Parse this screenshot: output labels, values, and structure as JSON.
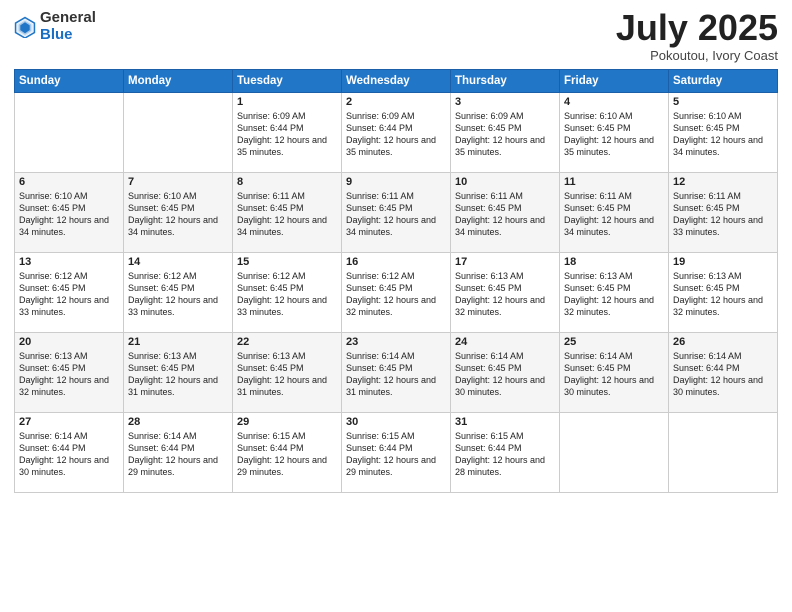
{
  "header": {
    "logo_general": "General",
    "logo_blue": "Blue",
    "title": "July 2025",
    "location": "Pokoutou, Ivory Coast"
  },
  "days_of_week": [
    "Sunday",
    "Monday",
    "Tuesday",
    "Wednesday",
    "Thursday",
    "Friday",
    "Saturday"
  ],
  "weeks": [
    [
      {
        "day": "",
        "sunrise": "",
        "sunset": "",
        "daylight": ""
      },
      {
        "day": "",
        "sunrise": "",
        "sunset": "",
        "daylight": ""
      },
      {
        "day": "1",
        "sunrise": "Sunrise: 6:09 AM",
        "sunset": "Sunset: 6:44 PM",
        "daylight": "Daylight: 12 hours and 35 minutes."
      },
      {
        "day": "2",
        "sunrise": "Sunrise: 6:09 AM",
        "sunset": "Sunset: 6:44 PM",
        "daylight": "Daylight: 12 hours and 35 minutes."
      },
      {
        "day": "3",
        "sunrise": "Sunrise: 6:09 AM",
        "sunset": "Sunset: 6:45 PM",
        "daylight": "Daylight: 12 hours and 35 minutes."
      },
      {
        "day": "4",
        "sunrise": "Sunrise: 6:10 AM",
        "sunset": "Sunset: 6:45 PM",
        "daylight": "Daylight: 12 hours and 35 minutes."
      },
      {
        "day": "5",
        "sunrise": "Sunrise: 6:10 AM",
        "sunset": "Sunset: 6:45 PM",
        "daylight": "Daylight: 12 hours and 34 minutes."
      }
    ],
    [
      {
        "day": "6",
        "sunrise": "Sunrise: 6:10 AM",
        "sunset": "Sunset: 6:45 PM",
        "daylight": "Daylight: 12 hours and 34 minutes."
      },
      {
        "day": "7",
        "sunrise": "Sunrise: 6:10 AM",
        "sunset": "Sunset: 6:45 PM",
        "daylight": "Daylight: 12 hours and 34 minutes."
      },
      {
        "day": "8",
        "sunrise": "Sunrise: 6:11 AM",
        "sunset": "Sunset: 6:45 PM",
        "daylight": "Daylight: 12 hours and 34 minutes."
      },
      {
        "day": "9",
        "sunrise": "Sunrise: 6:11 AM",
        "sunset": "Sunset: 6:45 PM",
        "daylight": "Daylight: 12 hours and 34 minutes."
      },
      {
        "day": "10",
        "sunrise": "Sunrise: 6:11 AM",
        "sunset": "Sunset: 6:45 PM",
        "daylight": "Daylight: 12 hours and 34 minutes."
      },
      {
        "day": "11",
        "sunrise": "Sunrise: 6:11 AM",
        "sunset": "Sunset: 6:45 PM",
        "daylight": "Daylight: 12 hours and 34 minutes."
      },
      {
        "day": "12",
        "sunrise": "Sunrise: 6:11 AM",
        "sunset": "Sunset: 6:45 PM",
        "daylight": "Daylight: 12 hours and 33 minutes."
      }
    ],
    [
      {
        "day": "13",
        "sunrise": "Sunrise: 6:12 AM",
        "sunset": "Sunset: 6:45 PM",
        "daylight": "Daylight: 12 hours and 33 minutes."
      },
      {
        "day": "14",
        "sunrise": "Sunrise: 6:12 AM",
        "sunset": "Sunset: 6:45 PM",
        "daylight": "Daylight: 12 hours and 33 minutes."
      },
      {
        "day": "15",
        "sunrise": "Sunrise: 6:12 AM",
        "sunset": "Sunset: 6:45 PM",
        "daylight": "Daylight: 12 hours and 33 minutes."
      },
      {
        "day": "16",
        "sunrise": "Sunrise: 6:12 AM",
        "sunset": "Sunset: 6:45 PM",
        "daylight": "Daylight: 12 hours and 32 minutes."
      },
      {
        "day": "17",
        "sunrise": "Sunrise: 6:13 AM",
        "sunset": "Sunset: 6:45 PM",
        "daylight": "Daylight: 12 hours and 32 minutes."
      },
      {
        "day": "18",
        "sunrise": "Sunrise: 6:13 AM",
        "sunset": "Sunset: 6:45 PM",
        "daylight": "Daylight: 12 hours and 32 minutes."
      },
      {
        "day": "19",
        "sunrise": "Sunrise: 6:13 AM",
        "sunset": "Sunset: 6:45 PM",
        "daylight": "Daylight: 12 hours and 32 minutes."
      }
    ],
    [
      {
        "day": "20",
        "sunrise": "Sunrise: 6:13 AM",
        "sunset": "Sunset: 6:45 PM",
        "daylight": "Daylight: 12 hours and 32 minutes."
      },
      {
        "day": "21",
        "sunrise": "Sunrise: 6:13 AM",
        "sunset": "Sunset: 6:45 PM",
        "daylight": "Daylight: 12 hours and 31 minutes."
      },
      {
        "day": "22",
        "sunrise": "Sunrise: 6:13 AM",
        "sunset": "Sunset: 6:45 PM",
        "daylight": "Daylight: 12 hours and 31 minutes."
      },
      {
        "day": "23",
        "sunrise": "Sunrise: 6:14 AM",
        "sunset": "Sunset: 6:45 PM",
        "daylight": "Daylight: 12 hours and 31 minutes."
      },
      {
        "day": "24",
        "sunrise": "Sunrise: 6:14 AM",
        "sunset": "Sunset: 6:45 PM",
        "daylight": "Daylight: 12 hours and 30 minutes."
      },
      {
        "day": "25",
        "sunrise": "Sunrise: 6:14 AM",
        "sunset": "Sunset: 6:45 PM",
        "daylight": "Daylight: 12 hours and 30 minutes."
      },
      {
        "day": "26",
        "sunrise": "Sunrise: 6:14 AM",
        "sunset": "Sunset: 6:44 PM",
        "daylight": "Daylight: 12 hours and 30 minutes."
      }
    ],
    [
      {
        "day": "27",
        "sunrise": "Sunrise: 6:14 AM",
        "sunset": "Sunset: 6:44 PM",
        "daylight": "Daylight: 12 hours and 30 minutes."
      },
      {
        "day": "28",
        "sunrise": "Sunrise: 6:14 AM",
        "sunset": "Sunset: 6:44 PM",
        "daylight": "Daylight: 12 hours and 29 minutes."
      },
      {
        "day": "29",
        "sunrise": "Sunrise: 6:15 AM",
        "sunset": "Sunset: 6:44 PM",
        "daylight": "Daylight: 12 hours and 29 minutes."
      },
      {
        "day": "30",
        "sunrise": "Sunrise: 6:15 AM",
        "sunset": "Sunset: 6:44 PM",
        "daylight": "Daylight: 12 hours and 29 minutes."
      },
      {
        "day": "31",
        "sunrise": "Sunrise: 6:15 AM",
        "sunset": "Sunset: 6:44 PM",
        "daylight": "Daylight: 12 hours and 28 minutes."
      },
      {
        "day": "",
        "sunrise": "",
        "sunset": "",
        "daylight": ""
      },
      {
        "day": "",
        "sunrise": "",
        "sunset": "",
        "daylight": ""
      }
    ]
  ]
}
